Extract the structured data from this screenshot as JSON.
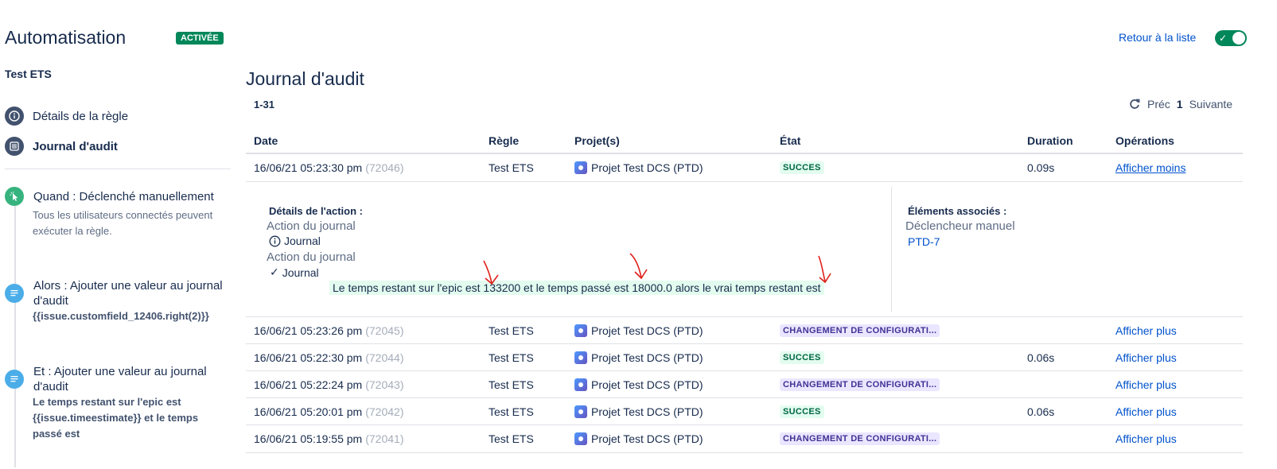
{
  "header": {
    "app_title": "Automatisation",
    "status_badge": "ACTIVÉE",
    "rule_name": "Test ETS",
    "back_link": "Retour à la liste",
    "toggle_state": "on"
  },
  "sidebar": {
    "items": [
      {
        "label": "Détails de la règle",
        "icon": "info-icon"
      },
      {
        "label": "Journal d'audit",
        "icon": "list-icon",
        "active": true
      }
    ],
    "steps": [
      {
        "title": "Quand : Déclenché manuellement",
        "desc": "Tous les utilisateurs connectés peuvent exécuter la règle.",
        "icon": "cursor-click-icon",
        "color": "#36b37e"
      },
      {
        "title": "Alors : Ajouter une valeur au journal d'audit",
        "code": "{{issue.customfield_12406.right(2)}}",
        "icon": "log-icon",
        "color": "#4bade8"
      },
      {
        "title": "Et : Ajouter une valeur au journal d'audit",
        "code": "Le temps restant sur l'epic est {{issue.timeestimate}} et le temps passé est",
        "icon": "log-icon",
        "color": "#4bade8"
      }
    ]
  },
  "main": {
    "title": "Journal d'audit",
    "range": "1-31",
    "pager": {
      "prev": "Préc",
      "current": "1",
      "next": "Suivante"
    },
    "columns": [
      "Date",
      "Règle",
      "Projet(s)",
      "État",
      "Duration",
      "Opérations"
    ],
    "rows": [
      {
        "date": "16/06/21 05:23:30 pm",
        "id": "(72046)",
        "rule": "Test ETS",
        "project": "Projet Test DCS (PTD)",
        "state": "SUCCES",
        "state_type": "success",
        "duration": "0.09s",
        "op": "Afficher moins"
      },
      {
        "date": "16/06/21 05:23:26 pm",
        "id": "(72045)",
        "rule": "Test ETS",
        "project": "Projet Test DCS (PTD)",
        "state": "CHANGEMENT DE CONFIGURATI...",
        "state_type": "config",
        "duration": "",
        "op": "Afficher plus"
      },
      {
        "date": "16/06/21 05:22:30 pm",
        "id": "(72044)",
        "rule": "Test ETS",
        "project": "Projet Test DCS (PTD)",
        "state": "SUCCES",
        "state_type": "success",
        "duration": "0.06s",
        "op": "Afficher plus"
      },
      {
        "date": "16/06/21 05:22:24 pm",
        "id": "(72043)",
        "rule": "Test ETS",
        "project": "Projet Test DCS (PTD)",
        "state": "CHANGEMENT DE CONFIGURATI...",
        "state_type": "config",
        "duration": "",
        "op": "Afficher plus"
      },
      {
        "date": "16/06/21 05:20:01 pm",
        "id": "(72042)",
        "rule": "Test ETS",
        "project": "Projet Test DCS (PTD)",
        "state": "SUCCES",
        "state_type": "success",
        "duration": "0.06s",
        "op": "Afficher plus"
      },
      {
        "date": "16/06/21 05:19:55 pm",
        "id": "(72041)",
        "rule": "Test ETS",
        "project": "Projet Test DCS (PTD)",
        "state": "CHANGEMENT DE CONFIGURATI...",
        "state_type": "config",
        "duration": "",
        "op": "Afficher plus"
      }
    ],
    "expanded": {
      "details_heading": "Détails de l'action :",
      "action1": "Action du journal",
      "action1_log": "Journal",
      "action2": "Action du journal",
      "action2_log": "Journal",
      "log_message": "Le temps restant sur l'epic est 133200 et le temps passé est 18000.0 alors le vrai temps restant est",
      "related_heading": "Éléments associés :",
      "trigger": "Déclencheur manuel",
      "issue_key": "PTD-7"
    }
  },
  "colors": {
    "accent": "#0052cc",
    "success": "#00875a",
    "annotation": "#e0201b"
  }
}
